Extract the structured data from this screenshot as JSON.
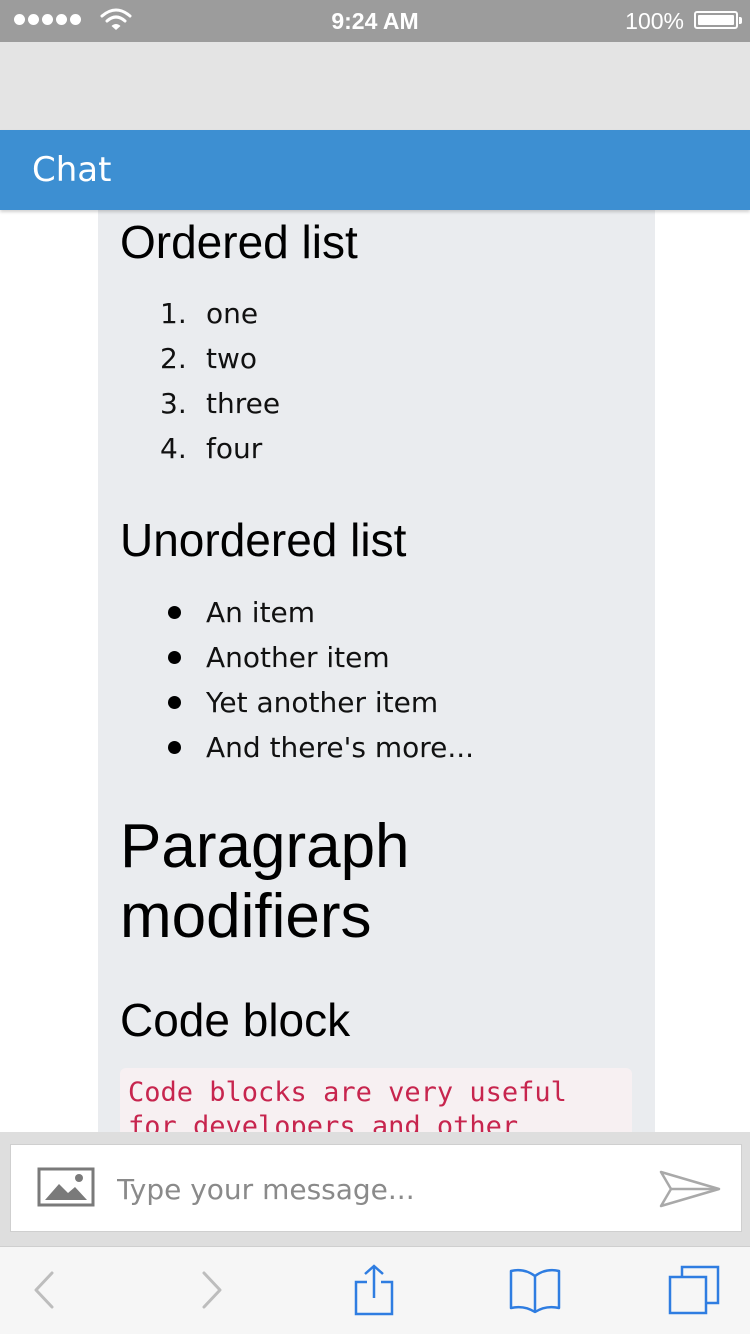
{
  "status_bar": {
    "time": "9:24 AM",
    "battery": "100%",
    "signal_dots": 5,
    "icons": [
      "signal-icon",
      "wifi-icon",
      "battery-icon"
    ]
  },
  "header": {
    "title": "Chat"
  },
  "message": {
    "ordered_list": {
      "heading": "Ordered list",
      "items": [
        {
          "marker": "1.",
          "text": "one"
        },
        {
          "marker": "2.",
          "text": "two"
        },
        {
          "marker": "3.",
          "text": "three"
        },
        {
          "marker": "4.",
          "text": "four"
        }
      ]
    },
    "unordered_list": {
      "heading": "Unordered list",
      "items": [
        {
          "text": "An item"
        },
        {
          "text": "Another item"
        },
        {
          "text": "Yet another item"
        },
        {
          "text": "And there's more..."
        }
      ]
    },
    "paragraph_heading": {
      "line1": "Paragraph",
      "line2": "modifiers"
    },
    "code_block": {
      "heading": "Code block",
      "line1": "Code blocks are very useful",
      "line2": "for developers and other"
    }
  },
  "input_bar": {
    "placeholder": "Type your message...",
    "icons": [
      "image-icon",
      "send-icon"
    ]
  },
  "browser_toolbar": {
    "icons": [
      "back-icon",
      "forward-icon",
      "share-icon",
      "bookmarks-icon",
      "tabs-icon"
    ]
  },
  "colors": {
    "header": "#3d8fd2",
    "card_background": "#eaecef",
    "code_text": "#c7254e",
    "code_background": "#f7f0f2",
    "toolbar_icon": "#2f7de1",
    "toolbar_icon_disabled": "#bdbdbd"
  }
}
